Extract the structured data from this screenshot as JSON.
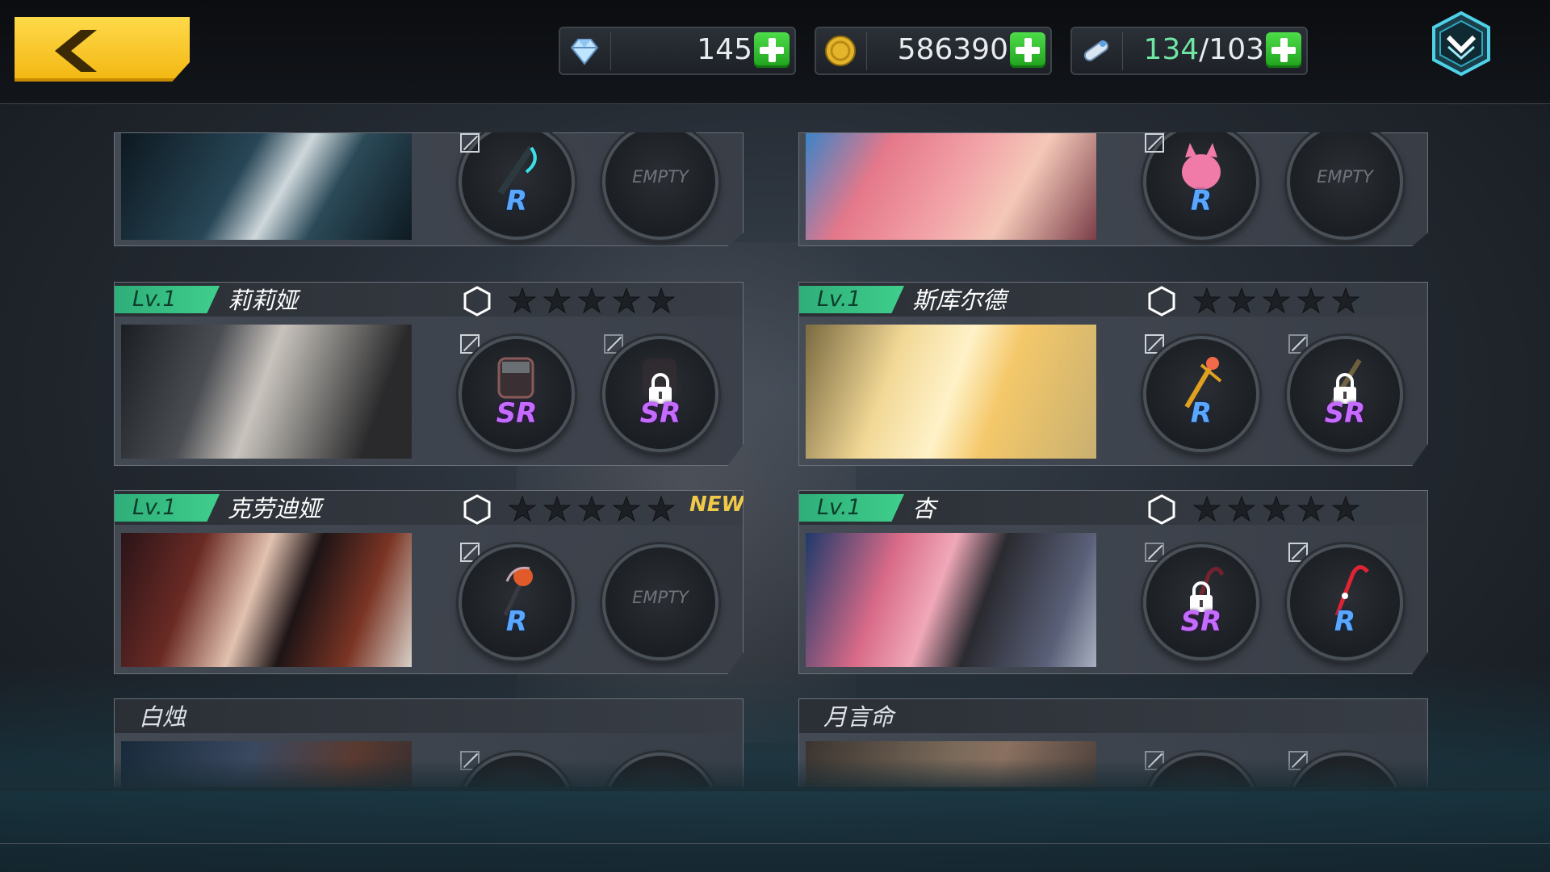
{
  "currencies": [
    {
      "name": "diamond",
      "icon": "diamond-icon",
      "value": "145"
    },
    {
      "name": "gold",
      "icon": "gold-coin-icon",
      "value": "586390"
    },
    {
      "name": "stamina",
      "icon": "stamina-pill-icon",
      "value_current": "134",
      "value_max": "/103"
    }
  ],
  "colors": {
    "accent_yellow": "#f2b711",
    "level_green": "#3fcf8c",
    "rarity_r": "#5aa7ff",
    "rarity_sr": "#c56bff"
  },
  "cards": [
    {
      "id": "top-left",
      "level": "",
      "name": "",
      "slot1": {
        "rarity": "R",
        "locked": false
      },
      "slot2": {
        "empty_text": "EMPTY"
      }
    },
    {
      "id": "top-right",
      "level": "",
      "name": "",
      "slot1": {
        "rarity": "R",
        "locked": false
      },
      "slot2": {
        "empty_text": "EMPTY"
      }
    },
    {
      "id": "lilia",
      "level": "Lv.1",
      "name": "莉莉娅",
      "stars_filled": 0,
      "stars_total": 5,
      "slot1": {
        "rarity": "SR",
        "locked": false
      },
      "slot2": {
        "rarity": "SR",
        "locked": true
      }
    },
    {
      "id": "skuld",
      "level": "Lv.1",
      "name": "斯库尔德",
      "stars_filled": 0,
      "stars_total": 5,
      "slot1": {
        "rarity": "R",
        "locked": false
      },
      "slot2": {
        "rarity": "SR",
        "locked": true
      }
    },
    {
      "id": "claudia",
      "level": "Lv.1",
      "name": "克劳迪娅",
      "stars_filled": 0,
      "stars_total": 5,
      "new_tag": "NEW!",
      "slot1": {
        "rarity": "R",
        "locked": false
      },
      "slot2": {
        "empty_text": "EMPTY"
      }
    },
    {
      "id": "xing",
      "level": "Lv.1",
      "name": "杏",
      "stars_filled": 0,
      "stars_total": 5,
      "slot1": {
        "rarity": "SR",
        "locked": true
      },
      "slot2": {
        "rarity": "R",
        "locked": false
      }
    },
    {
      "id": "baizhu",
      "name": "白烛"
    },
    {
      "id": "yueyanming",
      "name": "月言命"
    }
  ]
}
